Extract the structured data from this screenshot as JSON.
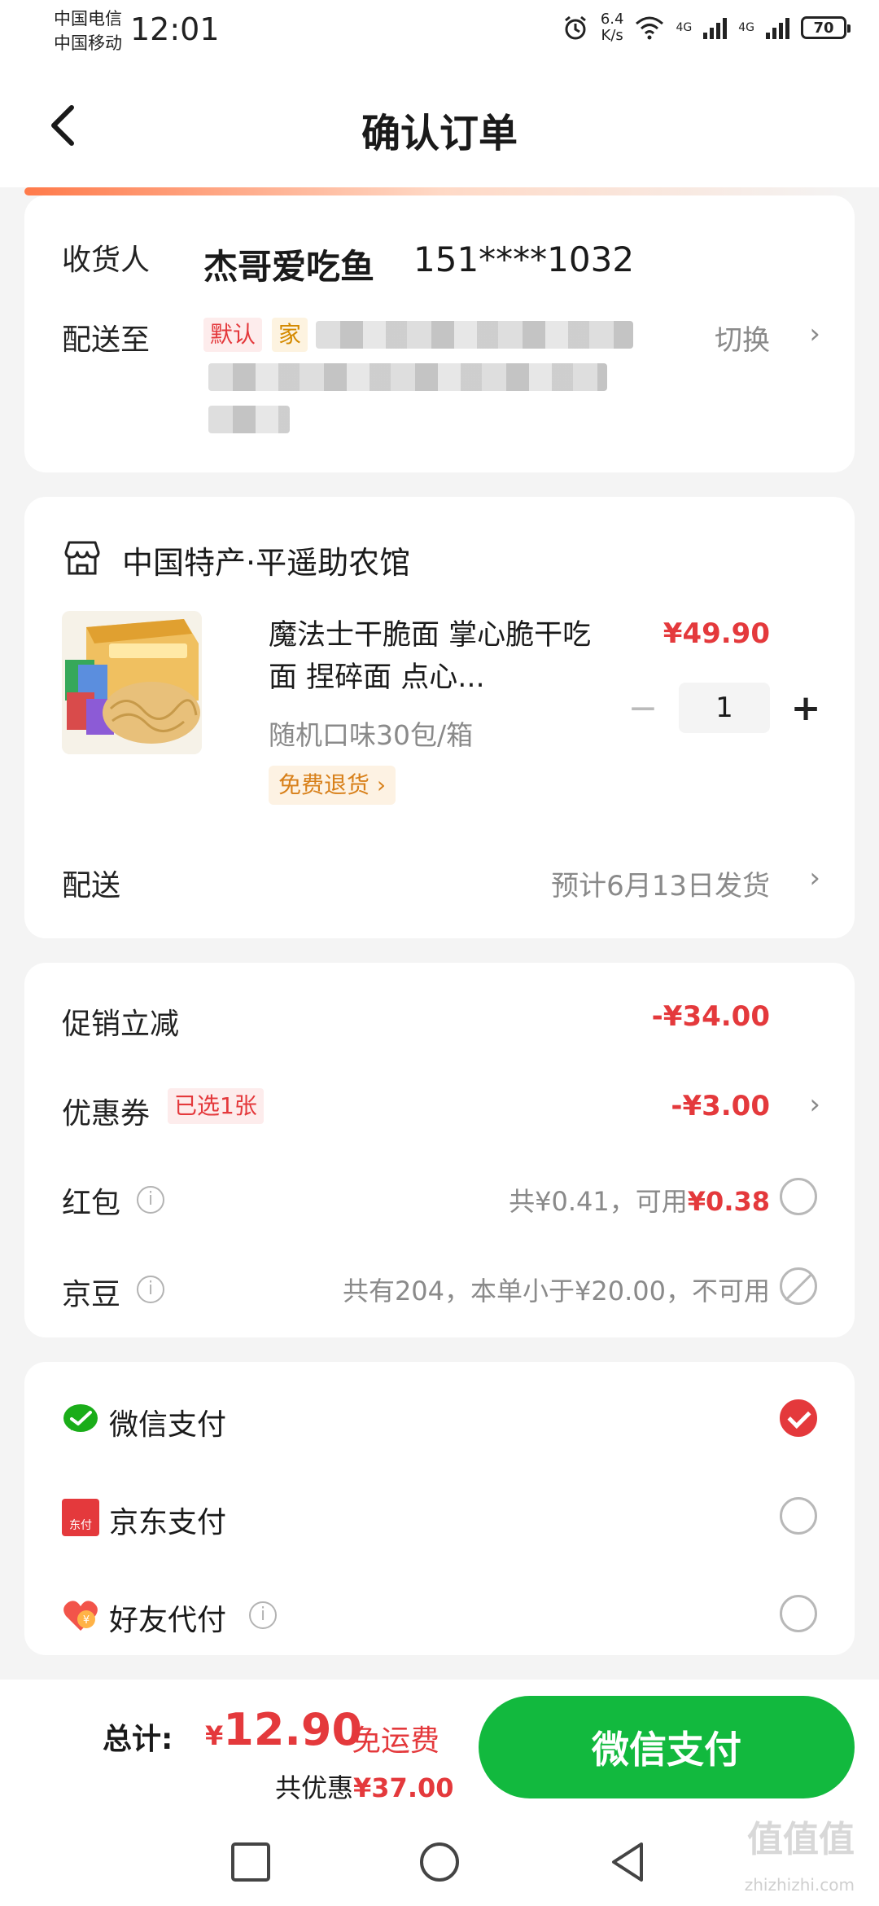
{
  "status_bar": {
    "carrier_1": "中国电信",
    "carrier_2": "中国移动",
    "time": "12:01",
    "net_speed": "6.4",
    "net_unit": "K/s",
    "signal_1": "4G",
    "signal_2": "4G",
    "battery": "70"
  },
  "header": {
    "title": "确认订单"
  },
  "address": {
    "recipient_label": "收货人",
    "recipient_name": "杰哥爱吃鱼",
    "recipient_phone": "151****1032",
    "ship_to_label": "配送至",
    "tag_default": "默认",
    "tag_home": "家",
    "switch_label": "切换"
  },
  "product_card": {
    "shop_name": "中国特产·平遥助农馆",
    "title": "魔法士干脆面 掌心脆干吃面 捏碎面 点心...",
    "spec": "随机口味30包/箱",
    "return_badge": "免费退货 ›",
    "price": "¥49.90",
    "quantity": "1",
    "minus": "−",
    "plus": "+",
    "delivery_label": "配送",
    "delivery_value": "预计6月13日发货"
  },
  "discounts": {
    "promo_label": "促销立减",
    "promo_value": "-¥34.00",
    "coupon_label": "优惠券",
    "coupon_tag": "已选1张",
    "coupon_value": "-¥3.00",
    "redpacket_label": "红包",
    "redpacket_total": "共¥0.41，可用",
    "redpacket_usable": "¥0.38",
    "jingdou_label": "京豆",
    "jingdou_value": "共有204，本单小于¥20.00，不可用",
    "info_mark": "i"
  },
  "payment": {
    "options": [
      {
        "label": "微信支付",
        "selected": true
      },
      {
        "label": "京东支付",
        "selected": false
      },
      {
        "label": "好友代付",
        "selected": false
      }
    ],
    "jd_icon_text": "东付"
  },
  "bottom_bar": {
    "total_label": "总计:",
    "currency": "¥",
    "total_amount": "12.90",
    "free_shipping": "免运费",
    "saving_label": "共优惠",
    "saving_amount": "¥37.00",
    "pay_button": "微信支付"
  },
  "watermark": {
    "logo": "值值值",
    "url": "zhizhizhi.com"
  },
  "colors": {
    "accent_red": "#e4393c",
    "pay_green": "#12b93e",
    "background": "#f4f4f4"
  }
}
